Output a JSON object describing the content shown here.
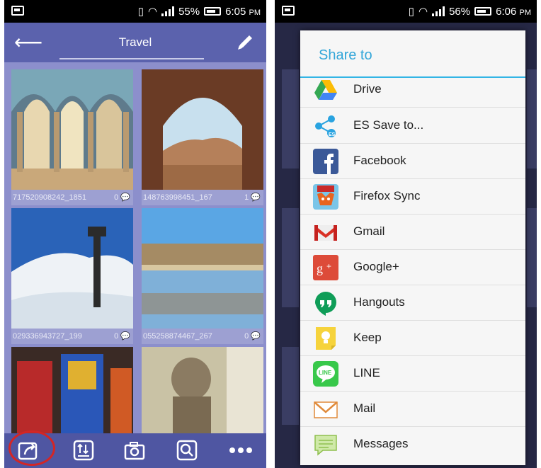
{
  "left": {
    "status": {
      "battery": "55%",
      "time": "6:05",
      "ampm": "PM"
    },
    "header": {
      "title": "Travel"
    },
    "photos": [
      {
        "id": "717520908242_1851",
        "count": "0"
      },
      {
        "id": "148763998451_167",
        "count": "1"
      },
      {
        "id": "029336943727_199",
        "count": "0"
      },
      {
        "id": "055258874467_267",
        "count": "0"
      }
    ]
  },
  "right": {
    "status": {
      "battery": "56%",
      "time": "6:06",
      "ampm": "PM"
    },
    "dialog": {
      "title": "Share to",
      "items": [
        {
          "label": "Drive",
          "icon": "drive-icon"
        },
        {
          "label": "ES Save to...",
          "icon": "es-save-icon"
        },
        {
          "label": "Facebook",
          "icon": "facebook-icon"
        },
        {
          "label": "Firefox Sync",
          "icon": "firefox-sync-icon"
        },
        {
          "label": "Gmail",
          "icon": "gmail-icon"
        },
        {
          "label": "Google+",
          "icon": "google-plus-icon"
        },
        {
          "label": "Hangouts",
          "icon": "hangouts-icon"
        },
        {
          "label": "Keep",
          "icon": "keep-icon"
        },
        {
          "label": "LINE",
          "icon": "line-icon"
        },
        {
          "label": "Mail",
          "icon": "mail-icon"
        },
        {
          "label": "Messages",
          "icon": "messages-icon"
        }
      ]
    }
  },
  "colors": {
    "header": "#5b62ad",
    "accent": "#33b5e5",
    "highlight": "#d32626"
  }
}
